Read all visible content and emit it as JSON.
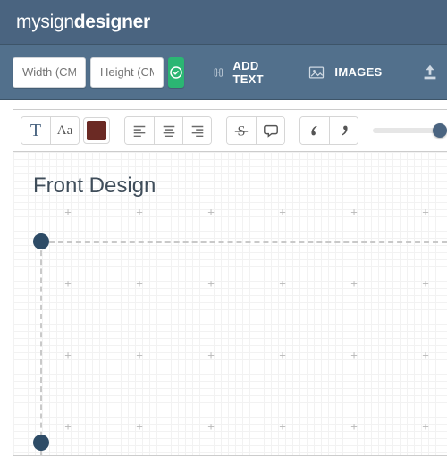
{
  "brand": {
    "part1": "mysign",
    "part2": "designer"
  },
  "size_inputs": {
    "width_placeholder": "Width (CM)",
    "height_placeholder": "Height (CM)"
  },
  "actions": {
    "add_text": "ADD TEXT",
    "images": "IMAGES"
  },
  "toolbar": {
    "font_btn": "T",
    "fontsize_btn": "Aa",
    "color_hex": "#6b2a24"
  },
  "canvas": {
    "title": "Front Design"
  }
}
